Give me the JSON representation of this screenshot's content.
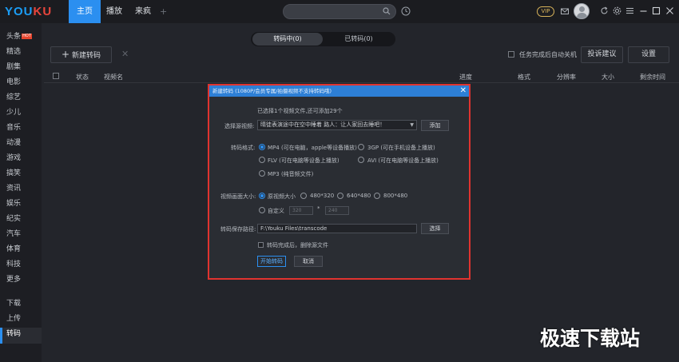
{
  "app": {
    "logo_part1": "YOU",
    "logo_part2": "KU",
    "tabs": [
      "主页",
      "播放",
      "来疯"
    ],
    "plus": "+",
    "vip": "VIP"
  },
  "sidebar": {
    "hot_badge": "HOT",
    "items": [
      "头条",
      "精选",
      "剧集",
      "电影",
      "综艺",
      "少儿",
      "音乐",
      "动漫",
      "游戏",
      "搞笑",
      "资讯",
      "娱乐",
      "纪实",
      "汽车",
      "体育",
      "科技",
      "更多",
      "下载",
      "上传",
      "转码"
    ],
    "active": "转码"
  },
  "toolbar": {
    "seg_converting": "转码中(0)",
    "seg_converted": "已转码(0)",
    "new_task": "新建转码",
    "new_task_plus": "+",
    "close": "✕",
    "auto_shutdown": "任务完成后自动关机",
    "feedback": "投诉建议",
    "settings": "设置"
  },
  "table": {
    "columns": [
      "状态",
      "视频名",
      "进度",
      "格式",
      "分辨率",
      "大小",
      "剩余时间"
    ]
  },
  "dialog": {
    "title": "新建转码 (1080P/会员专属/拍摄视频不支持转码哦)",
    "close": "✕",
    "selected_info": "已选择1个视频文件,还可添加29个",
    "source_label": "选择源视频:",
    "source_value": "晴徒表演途中在空中睡着 路人：让人家回去睡吧！",
    "add": "添加",
    "format_label": "转码格式:",
    "formats": [
      {
        "name": "MP4 (可在电脑，apple等设备播放)",
        "selected": true
      },
      {
        "name": "3GP (可在手机设备上播放)",
        "selected": false
      },
      {
        "name": "FLV (可在电脑等设备上播放)",
        "selected": false
      },
      {
        "name": "AVI (可在电脑等设备上播放)",
        "selected": false
      },
      {
        "name": "MP3 (纯音频文件)",
        "selected": false
      }
    ],
    "size_label": "视频画面大小:",
    "sizes": [
      {
        "name": "原视频大小",
        "selected": true
      },
      {
        "name": "480*320",
        "selected": false
      },
      {
        "name": "640*480",
        "selected": false
      },
      {
        "name": "800*480",
        "selected": false
      }
    ],
    "custom": "自定义",
    "custom_w": "320",
    "custom_times": "*",
    "custom_h": "240",
    "path_label": "转码保存路径:",
    "path_value": "F:\\Youku Files\\transcode",
    "browse": "选择",
    "delete_source": "转码完成后，删除源文件",
    "start": "开始转码",
    "cancel": "取消"
  },
  "watermark": "极速下载站",
  "colors": {
    "accent": "#2b8ff0",
    "dialog_border": "#e0332f",
    "logo_blue": "#1b9df5",
    "logo_red": "#e8453c"
  }
}
